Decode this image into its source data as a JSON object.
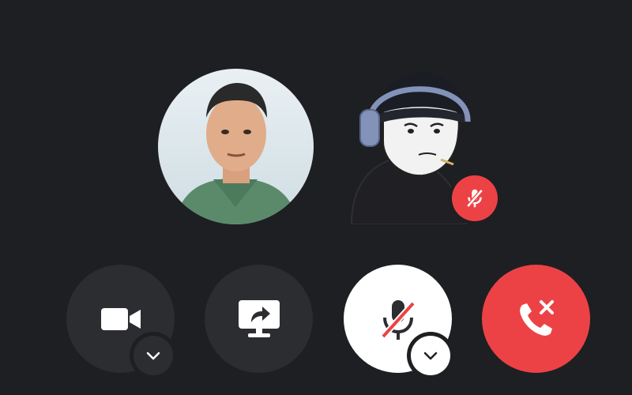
{
  "participants": [
    {
      "id": "participant-1",
      "muted": false,
      "avatar_icon": "user-avatar-icon"
    },
    {
      "id": "participant-2",
      "muted": true,
      "avatar_icon": "user-avatar-icon",
      "status_icon": "microphone-muted-icon"
    }
  ],
  "controls": {
    "camera": {
      "icon": "video-camera-icon",
      "state": "off",
      "options_icon": "chevron-down-icon"
    },
    "screen_share": {
      "icon": "screen-share-icon"
    },
    "microphone": {
      "icon": "microphone-muted-icon",
      "state": "muted",
      "options_icon": "chevron-down-icon"
    },
    "leave": {
      "icon": "phone-hangup-icon"
    }
  },
  "colors": {
    "background": "#1e1f22",
    "button_dark": "#2b2d31",
    "button_light": "#ffffff",
    "danger": "#ed4245"
  }
}
